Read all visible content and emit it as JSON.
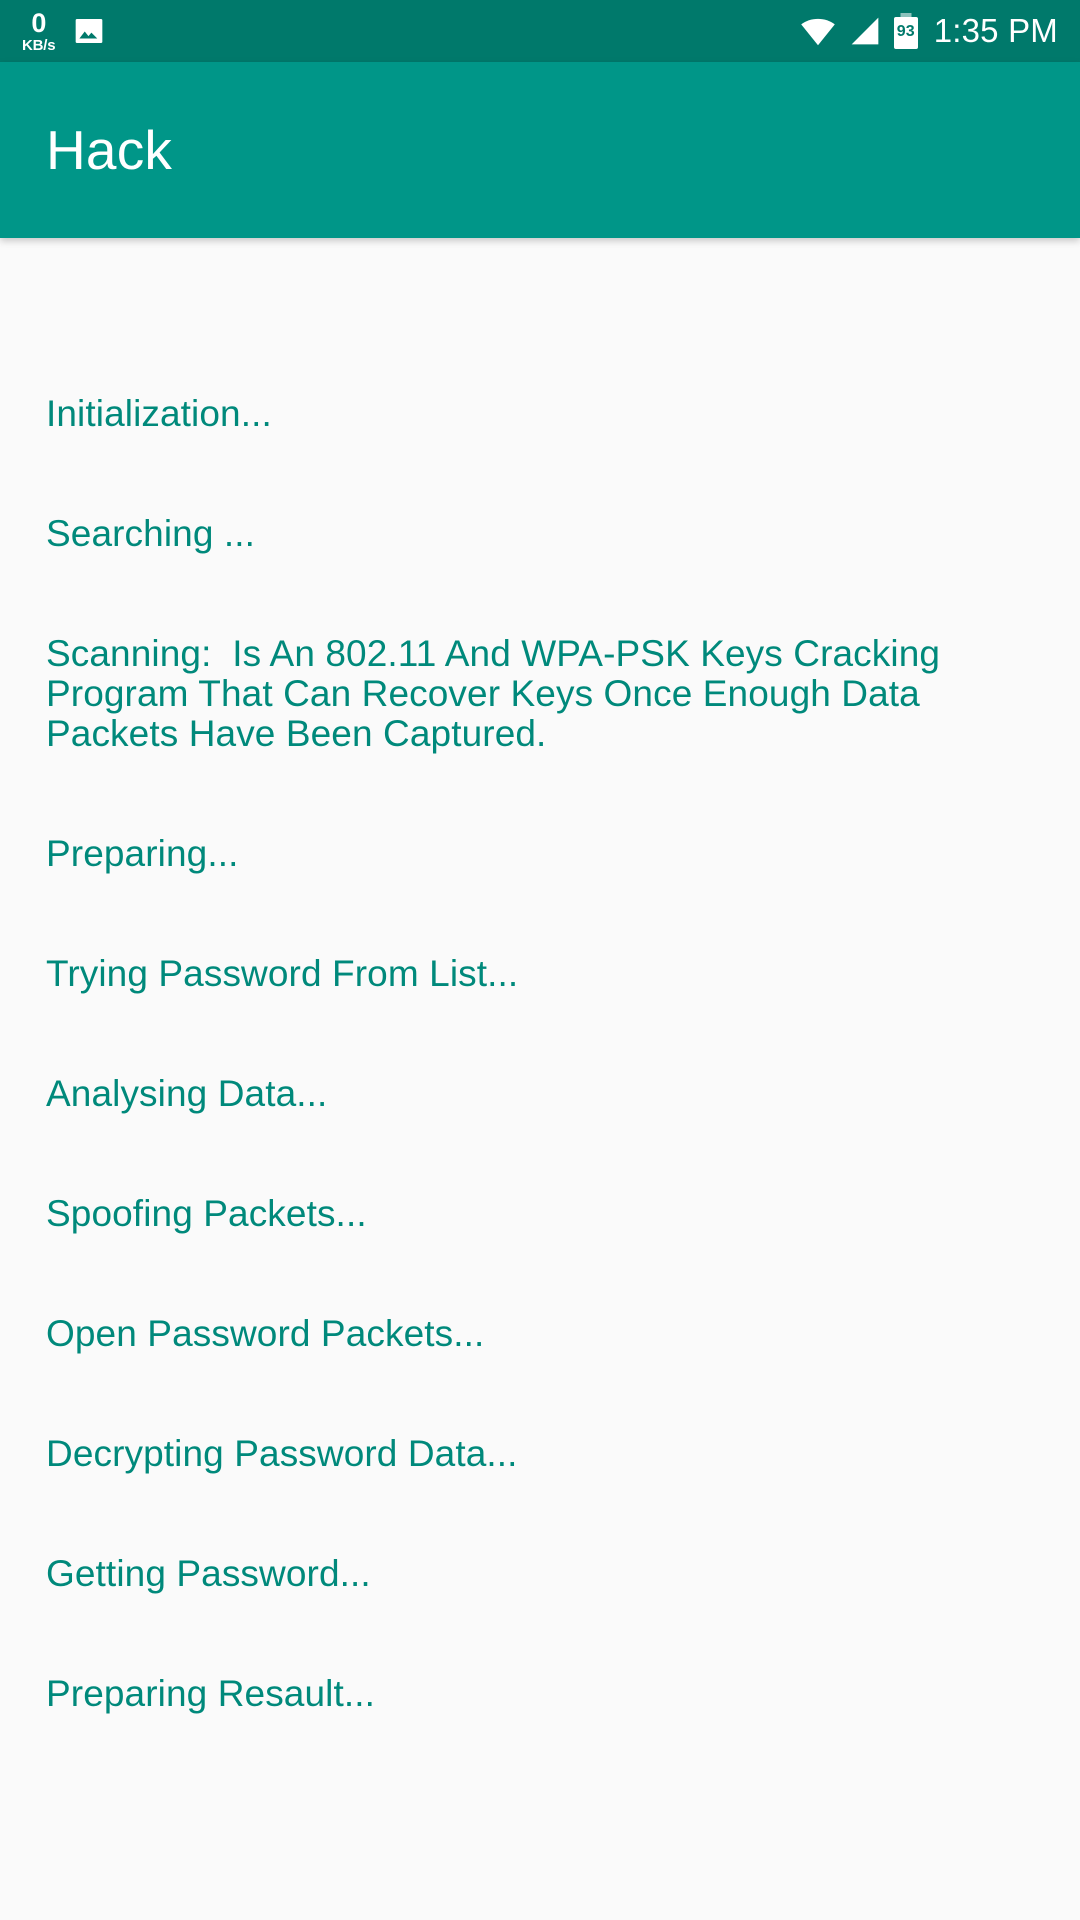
{
  "status_bar": {
    "network_speed_value": "0",
    "network_speed_unit": "KB/s",
    "photo_icon": "photo-icon",
    "wifi_icon": "wifi-icon",
    "signal_icon": "cell-signal-icon",
    "battery_level": "93",
    "time": "1:35 PM",
    "background_color": "#00796B"
  },
  "app_bar": {
    "title": "Hack",
    "background_color": "#009688",
    "text_color": "#FFFFFF"
  },
  "content": {
    "background_color": "#FAFAFA",
    "text_color": "#00897B",
    "log_lines": [
      "Initialization...",
      "Searching ...",
      "Scanning:  Is An 802.11 And WPA-PSK Keys Cracking Program That Can Recover Keys Once Enough Data Packets Have Been Captured.",
      "Preparing...",
      "Trying Password From List...",
      "Analysing Data...",
      "Spoofing Packets...",
      "Open Password Packets...",
      "Decrypting Password Data...",
      "Getting Password...",
      "Preparing Resault..."
    ]
  }
}
